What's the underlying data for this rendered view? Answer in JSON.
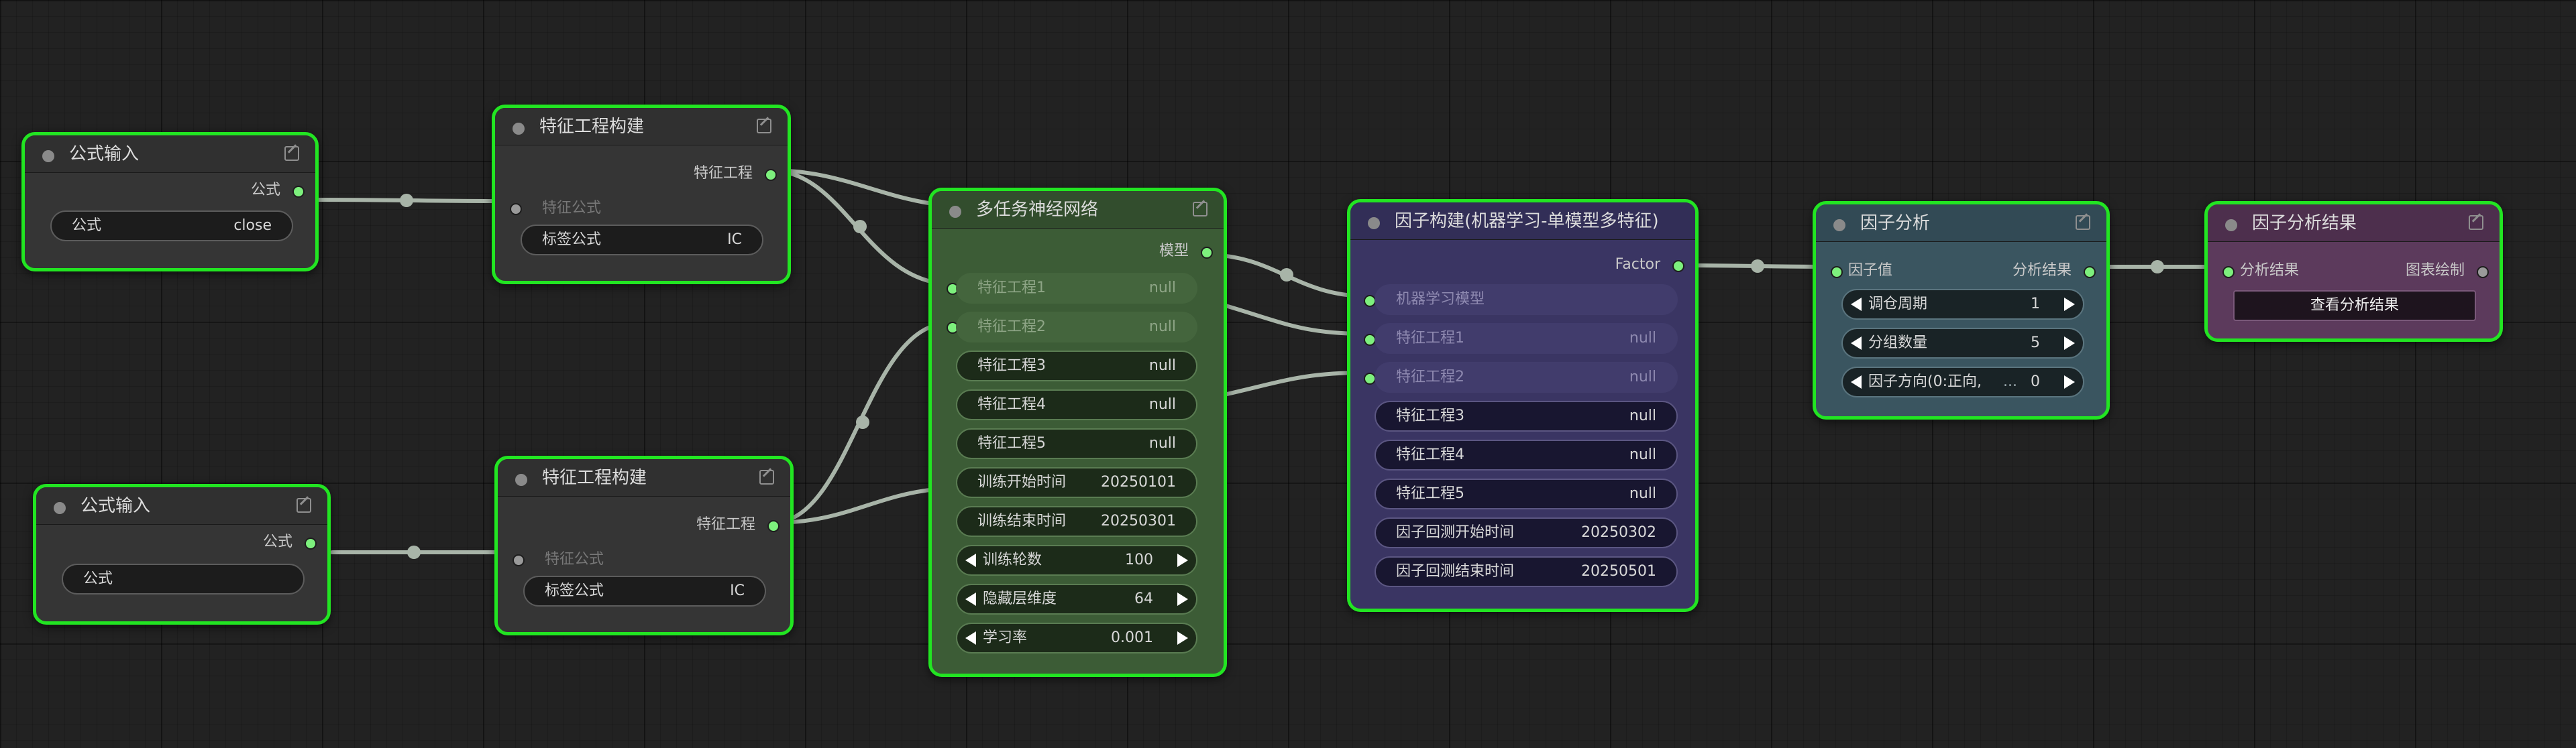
{
  "nodes": {
    "formula_input_1": {
      "title": "公式输入",
      "output_label": "公式",
      "widget_label": "公式",
      "widget_value": "close"
    },
    "feature_build_1": {
      "title": "特征工程构建",
      "output_label": "特征工程",
      "input_label": "特征公式",
      "widget_label": "标签公式",
      "widget_value": "IC"
    },
    "formula_input_2": {
      "title": "公式输入",
      "output_label": "公式",
      "widget_label": "公式",
      "widget_value": ""
    },
    "feature_build_2": {
      "title": "特征工程构建",
      "output_label": "特征工程",
      "input_label": "特征公式",
      "widget_label": "标签公式",
      "widget_value": "IC"
    },
    "multitask_nn": {
      "title": "多任务神经网络",
      "output_label": "模型",
      "widgets": [
        {
          "label": "特征工程1",
          "value": "null"
        },
        {
          "label": "特征工程2",
          "value": "null"
        },
        {
          "label": "特征工程3",
          "value": "null"
        },
        {
          "label": "特征工程4",
          "value": "null"
        },
        {
          "label": "特征工程5",
          "value": "null"
        },
        {
          "label": "训练开始时间",
          "value": "20250101"
        },
        {
          "label": "训练结束时间",
          "value": "20250301"
        },
        {
          "label": "训练轮数",
          "value": "100"
        },
        {
          "label": "隐藏层维度",
          "value": "64"
        },
        {
          "label": "学习率",
          "value": "0.001"
        }
      ]
    },
    "factor_build": {
      "title": "因子构建(机器学习-单模型多特征)",
      "output_label": "Factor",
      "widgets": [
        {
          "label": "机器学习模型",
          "value": ""
        },
        {
          "label": "特征工程1",
          "value": "null"
        },
        {
          "label": "特征工程2",
          "value": "null"
        },
        {
          "label": "特征工程3",
          "value": "null"
        },
        {
          "label": "特征工程4",
          "value": "null"
        },
        {
          "label": "特征工程5",
          "value": "null"
        },
        {
          "label": "因子回测开始时间",
          "value": "20250302"
        },
        {
          "label": "因子回测结束时间",
          "value": "20250501"
        }
      ]
    },
    "factor_analysis": {
      "title": "因子分析",
      "input_label": "因子值",
      "output_label": "分析结果",
      "widgets": [
        {
          "label": "调仓周期",
          "value": "1"
        },
        {
          "label": "分组数量",
          "value": "5"
        },
        {
          "label": "因子方向(0:正向,",
          "value": "0",
          "ellipsis": "..."
        }
      ]
    },
    "factor_result": {
      "title": "因子分析结果",
      "input_label": "分析结果",
      "output_label": "图表绘制",
      "button_label": "查看分析结果"
    }
  },
  "colors": {
    "selection_border": "#22e522",
    "slot_active": "#7df07d",
    "link": "#a8b4a8",
    "node_green": "#3c5c36",
    "node_purple": "#3a3563",
    "node_slate": "#3a5560",
    "node_plum": "#5c3a5c"
  }
}
